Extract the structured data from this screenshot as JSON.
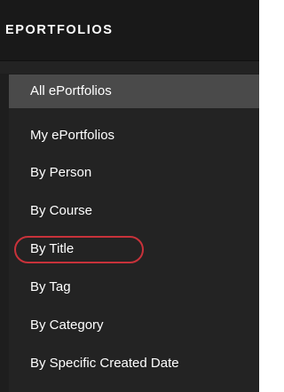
{
  "header": {
    "title": "EPORTFOLIOS"
  },
  "menu": {
    "items": [
      {
        "label": "All ePortfolios",
        "active": true
      },
      {
        "label": "My ePortfolios",
        "active": false
      },
      {
        "label": "By Person",
        "active": false
      },
      {
        "label": "By Course",
        "active": false
      },
      {
        "label": "By Title",
        "active": false,
        "highlighted": true
      },
      {
        "label": "By Tag",
        "active": false
      },
      {
        "label": "By Category",
        "active": false
      },
      {
        "label": "By Specific Created Date",
        "active": false
      }
    ]
  },
  "colors": {
    "header_background": "#191919",
    "menu_background": "#232323",
    "active_item_background": "#4a4a4a",
    "text": "#ffffff",
    "highlight_ring": "#c8323a"
  }
}
